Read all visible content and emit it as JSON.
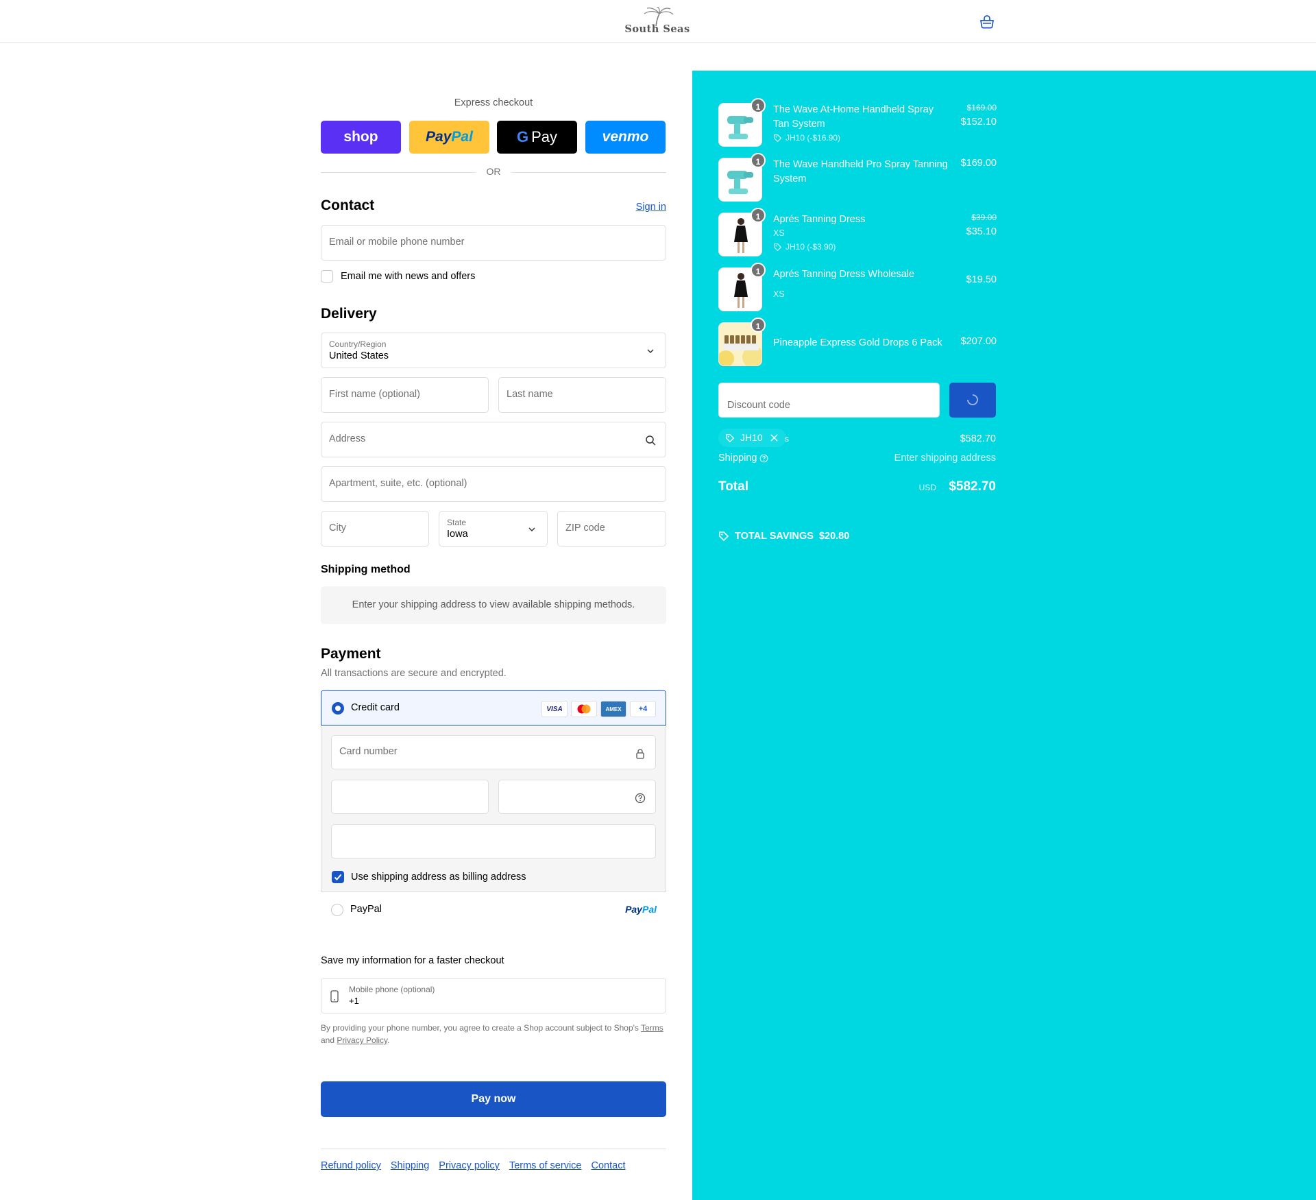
{
  "header": {
    "brand": "South Seas"
  },
  "express": {
    "label": "Express checkout",
    "shop": "shop",
    "paypal_a": "Pay",
    "paypal_b": "Pal",
    "gpay": "Pay",
    "venmo": "venmo",
    "or": "OR"
  },
  "contact": {
    "title": "Contact",
    "sign_in": "Sign in",
    "email_placeholder": "Email or mobile phone number",
    "newsletter_label": "Email me with news and offers"
  },
  "delivery": {
    "title": "Delivery",
    "country_label": "Country/Region",
    "country_value": "United States",
    "first_name_placeholder": "First name (optional)",
    "last_name_placeholder": "Last name",
    "address_placeholder": "Address",
    "apartment_placeholder": "Apartment, suite, etc. (optional)",
    "city_placeholder": "City",
    "state_label": "State",
    "state_value": "Iowa",
    "zip_placeholder": "ZIP code"
  },
  "shipping_method": {
    "title": "Shipping method",
    "message": "Enter your shipping address to view available shipping methods."
  },
  "payment": {
    "title": "Payment",
    "subtitle": "All transactions are secure and encrypted.",
    "credit_card_label": "Credit card",
    "card_logos": [
      "VISA",
      "",
      "AMEX",
      "+4"
    ],
    "card_number_placeholder": "Card number",
    "billing_label": "Use shipping address as billing address",
    "paypal_label": "PayPal",
    "paypal_logo_a": "Pay",
    "paypal_logo_b": "Pal"
  },
  "save_info": {
    "title": "Save my information for a faster checkout",
    "phone_label": "Mobile phone (optional)",
    "phone_value": "+1",
    "legal_text": "By providing your phone number, you agree to create a Shop account subject to Shop's",
    "terms": "Terms",
    "and": "and",
    "privacy": "Privacy Policy",
    "period": "."
  },
  "pay_now": "Pay now",
  "footer": {
    "links": [
      "Refund policy",
      "Shipping",
      "Privacy policy",
      "Terms of service",
      "Contact"
    ]
  },
  "order": {
    "items": [
      {
        "qty": "1",
        "name": "The Wave At-Home Handheld Spray Tan System",
        "old_price": "$169.00",
        "price": "$152.10",
        "discount": "JH10 (-$16.90)"
      },
      {
        "qty": "1",
        "name": "The Wave Handheld Pro Spray Tanning System",
        "price": "$169.00"
      },
      {
        "qty": "1",
        "name": "Aprés Tanning Dress",
        "variant": "XS",
        "old_price": "$39.00",
        "price": "$35.10",
        "discount": "JH10 (-$3.90)"
      },
      {
        "qty": "1",
        "name": "Aprés Tanning Dress Wholesale",
        "variant": "XS",
        "price": "$19.50"
      },
      {
        "qty": "1",
        "name": "Pineapple Express Gold Drops 6 Pack",
        "price": "$207.00"
      }
    ],
    "discount_placeholder": "Discount code",
    "applied_code": "JH10",
    "subtotal_label_fragment": "s",
    "subtotal": "$582.70",
    "shipping_label": "Shipping",
    "shipping_value": "Enter shipping address",
    "total_label": "Total",
    "currency": "USD",
    "total": "$582.70",
    "savings_label": "TOTAL SAVINGS",
    "savings_value": "$20.80"
  },
  "colors": {
    "accent": "#1a55c6",
    "summary_bg": "#00d8e1"
  }
}
